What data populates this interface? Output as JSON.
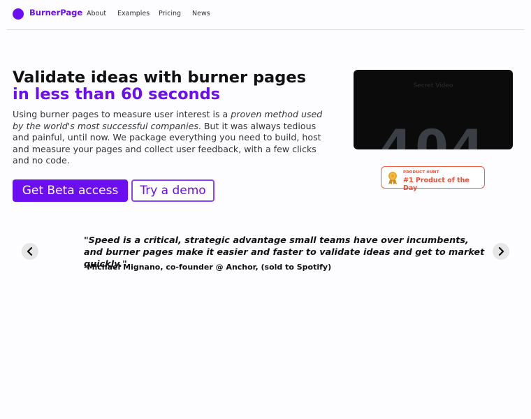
{
  "nav": {
    "brand": "BurnerPage",
    "links": [
      "About",
      "Examples",
      "Pricing",
      "News"
    ]
  },
  "hero": {
    "title_line1": "Validate ideas with burner pages",
    "title_line2": "in less than 60 seconds",
    "lede_part1": "Using burner pages to measure user interest is a ",
    "lede_emphasis": "proven method used by the world's most successful companies",
    "lede_part2": ". But it was always tedious and painful, until now. We package everything you need to build, host and measure your pages and collect user feedback, with a few clicks and no code.",
    "cta_primary": "Get Beta access",
    "cta_secondary": "Try a demo"
  },
  "video": {
    "caption": "Secret Video",
    "error_code": "404"
  },
  "product_hunt": {
    "eyebrow": "PRODUCT HUNT",
    "title": "#1 Product of the Day",
    "medal_icon": "medal-icon"
  },
  "testimonial": {
    "quote": "\"Speed is a critical, strategic advantage small teams have over incumbents, and burner pages make it easier and faster to validate ideas and get to market quickly.\"",
    "author": "-Michael Mignano, co-founder @ Anchor, (sold to Spotify)"
  },
  "colors": {
    "brand": "#6b0ff0",
    "badge": "#e0523c",
    "video_bg": "#0b0b0b"
  }
}
